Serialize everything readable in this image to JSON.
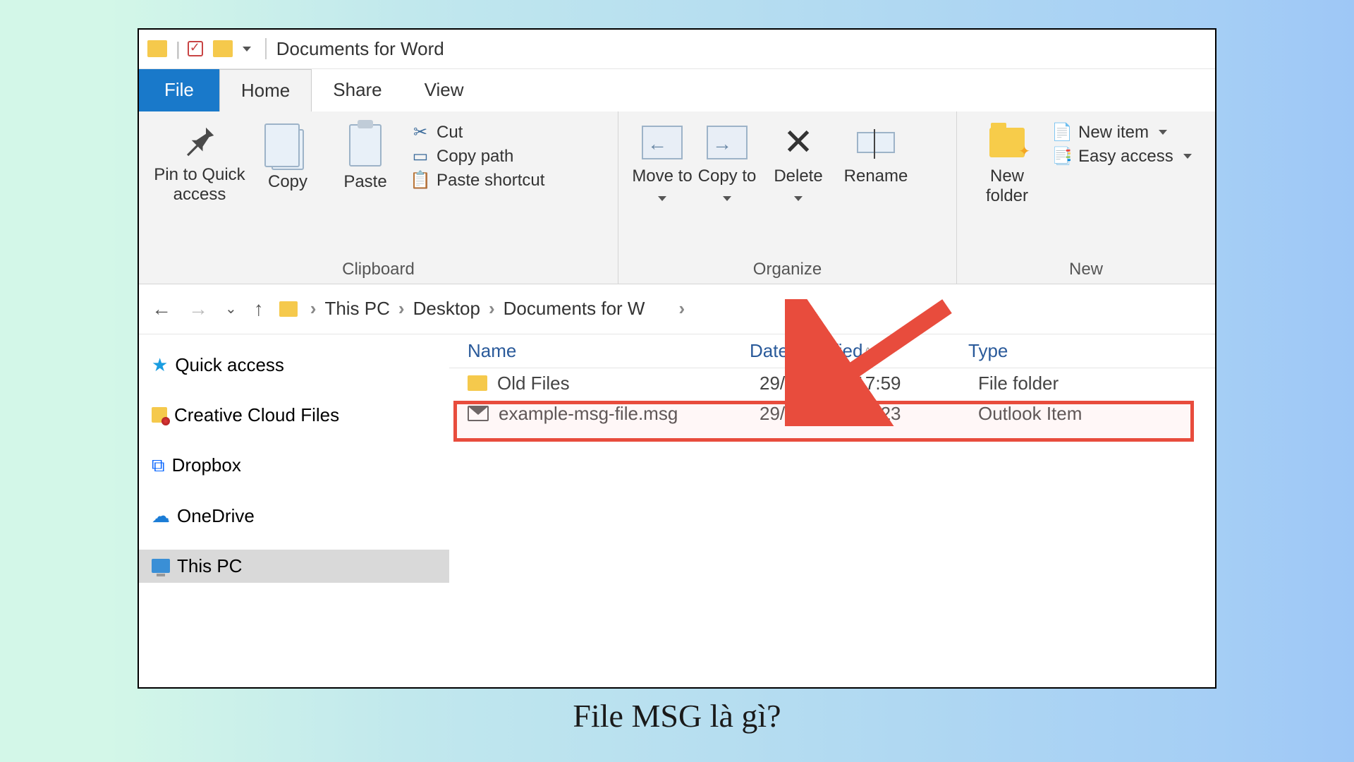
{
  "window": {
    "title": "Documents for Word"
  },
  "tabs": {
    "file": "File",
    "home": "Home",
    "share": "Share",
    "view": "View"
  },
  "ribbon": {
    "clipboard": {
      "label": "Clipboard",
      "pin": "Pin to Quick access",
      "copy": "Copy",
      "paste": "Paste",
      "cut": "Cut",
      "copy_path": "Copy path",
      "paste_shortcut": "Paste shortcut"
    },
    "organize": {
      "label": "Organize",
      "move_to": "Move to",
      "copy_to": "Copy to",
      "delete": "Delete",
      "rename": "Rename"
    },
    "new": {
      "label": "New",
      "new_folder": "New folder",
      "new_item": "New item",
      "easy_access": "Easy access"
    }
  },
  "breadcrumb": {
    "root": "This PC",
    "seg1": "Desktop",
    "seg2": "Documents for W"
  },
  "nav": {
    "quick_access": "Quick access",
    "creative_cloud": "Creative Cloud Files",
    "dropbox": "Dropbox",
    "onedrive": "OneDrive",
    "this_pc": "This PC"
  },
  "columns": {
    "name": "Name",
    "date": "Date modified",
    "type": "Type"
  },
  "files": [
    {
      "name": "Old Files",
      "date": "29/11/2020 17:59",
      "type": "File folder",
      "icon": "folder"
    },
    {
      "name": "example-msg-file.msg",
      "date": "29/11/2020 17:23",
      "type": "Outlook Item",
      "icon": "envelope"
    }
  ],
  "caption": "File MSG là gì?"
}
